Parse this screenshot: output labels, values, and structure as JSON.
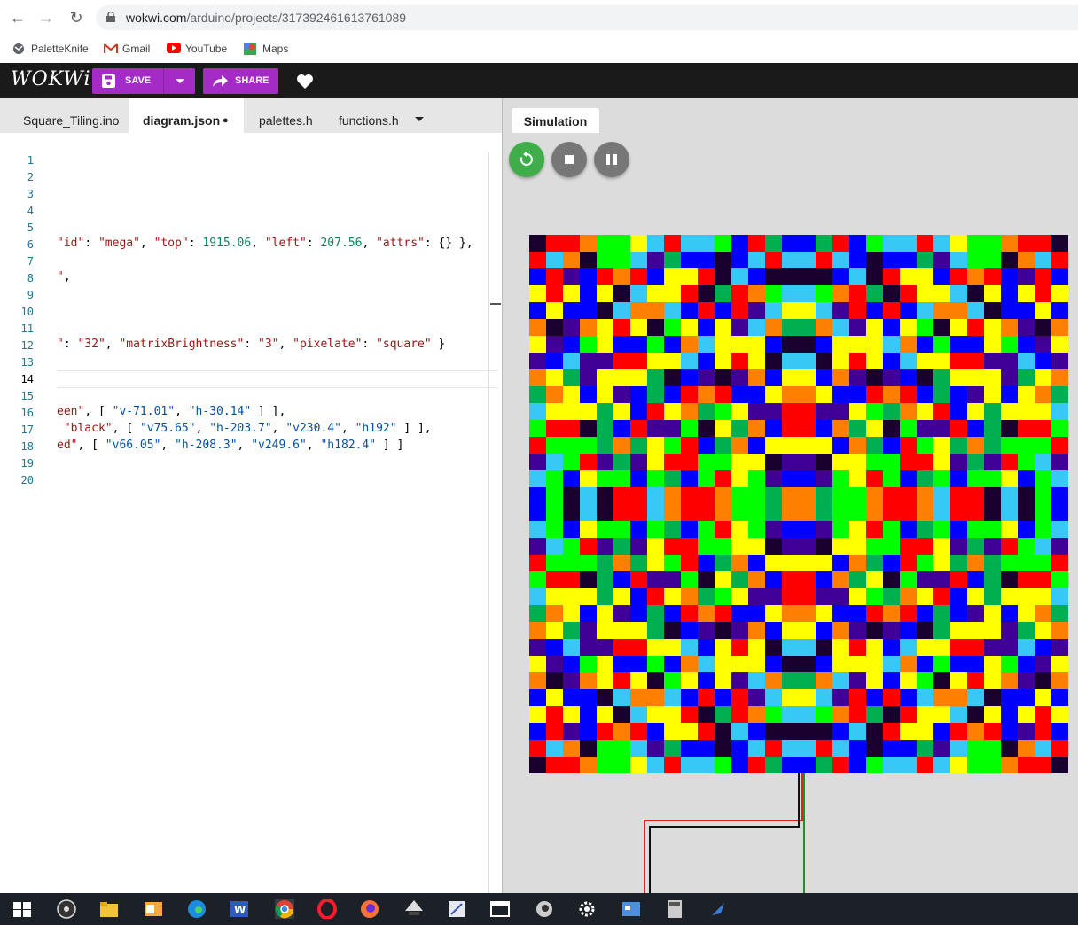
{
  "browser": {
    "url_host": "wokwi.com",
    "url_path": "/arduino/projects/317392461613761089",
    "bookmarks": [
      "PaletteKnife",
      "Gmail",
      "YouTube",
      "Maps"
    ]
  },
  "app": {
    "logo": "WOKWi",
    "save_label": "SAVE",
    "share_label": "SHARE"
  },
  "editor": {
    "tabs": [
      "Square_Tiling.ino",
      "diagram.json",
      "palettes.h",
      "functions.h"
    ],
    "active_tab": "diagram.json",
    "modified_marker": "●",
    "current_line": 14,
    "line_numbers": [
      "1",
      "2",
      "3",
      "4",
      "5",
      "6",
      "7",
      "8",
      "9",
      "10",
      "11",
      "12",
      "13",
      "14",
      "15",
      "16",
      "17",
      "18",
      "19",
      "20"
    ],
    "code_lines": {
      "l6": "\"id\": \"mega\", \"top\": 1915.06, \"left\": 207.56, \"attrs\": {} },",
      "l8": "\",",
      "l12": ": \"32\", \"matrixBrightness\": \"3\", \"pixelate\": \"square\" }",
      "l16": "een\", [ \"v-71.01\", \"h-30.14\" ] ],",
      "l17": " \"black\", [ \"v75.65\", \"h-203.7\", \"v230.4\", \"h192\" ] ],",
      "l18": "ed\", [ \"v66.05\", \"h-208.3\", \"v249.6\", \"h182.4\" ] ]"
    }
  },
  "simulation": {
    "tab_label": "Simulation",
    "matrix_size": 32,
    "palette": [
      "#ff0000",
      "#ffff00",
      "#00ff00",
      "#0000ff",
      "#38c8f5",
      "#400098",
      "#1a002e",
      "#00b050",
      "#ff8000",
      "#ff0000",
      "#ffff00",
      "#0000ff"
    ],
    "colors": {
      "restart": "#3fae4a",
      "stop": "#777777",
      "accent": "#a42bc6"
    }
  },
  "taskbar": {
    "icons": [
      "windows-start-icon",
      "obs-icon",
      "file-explorer-icon",
      "outlook-icon",
      "edge-icon",
      "word-icon",
      "chrome-icon",
      "opera-icon",
      "firefox-icon",
      "inkscape-icon",
      "app-icon",
      "window-icon",
      "eye-app-icon",
      "settings-icon",
      "calendar-app-icon",
      "calculator-icon",
      "tools-icon"
    ]
  }
}
